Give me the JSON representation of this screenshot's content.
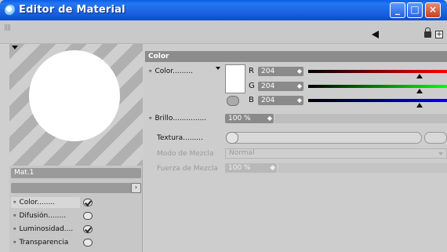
{
  "window": {
    "title": "Editor de Material"
  },
  "preview": {
    "material_name": "Mat.1"
  },
  "channels": [
    {
      "label": "Color",
      "checked": true,
      "active": true
    },
    {
      "label": "Difusión",
      "checked": false,
      "active": false
    },
    {
      "label": "Luminosidad",
      "checked": true,
      "active": false
    },
    {
      "label": "Transparencia",
      "checked": false,
      "active": false
    }
  ],
  "color_section": {
    "header": "Color",
    "color_label": "Color",
    "r_label": "R",
    "r_value": "204",
    "g_label": "G",
    "g_value": "204",
    "b_label": "B",
    "b_value": "204",
    "brightness_label": "Brillo",
    "brightness_value": "100 %",
    "texture_label": "Textura",
    "blend_mode_label": "Modo de Mezcla",
    "blend_mode_value": "Normal",
    "blend_strength_label": "Fuerza de Mezcla",
    "blend_strength_value": "100 %"
  },
  "icons": {
    "back": "back-arrow-icon",
    "lock": "lock-icon",
    "expand": "expand-icon",
    "app": "app-icon"
  },
  "colors": {
    "titlebar": "#1c63e2",
    "header": "#8c8c8c",
    "swatch": "#ffffff"
  }
}
